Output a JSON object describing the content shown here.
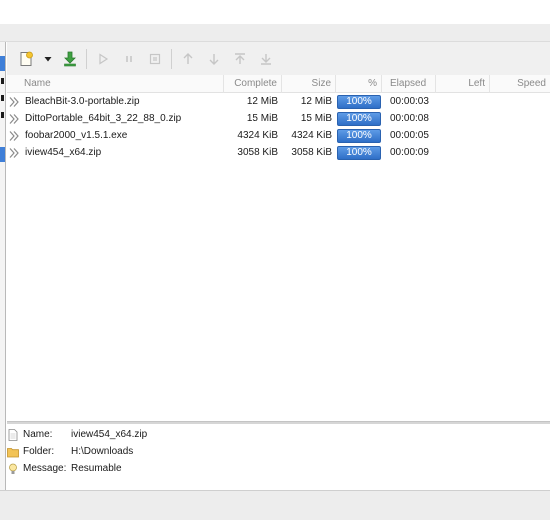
{
  "toolbar": {
    "buttons": [
      {
        "icon": "new-download-icon",
        "enabled": true
      },
      {
        "icon": "dropdown-arrow-icon",
        "enabled": true
      },
      {
        "icon": "download-icon",
        "enabled": true
      },
      {
        "icon": "start-icon",
        "enabled": false
      },
      {
        "icon": "pause-icon",
        "enabled": false
      },
      {
        "icon": "stop-icon",
        "enabled": false
      },
      {
        "icon": "move-up-icon",
        "enabled": false
      },
      {
        "icon": "move-down-icon",
        "enabled": false
      },
      {
        "icon": "move-top-icon",
        "enabled": false
      },
      {
        "icon": "move-bottom-icon",
        "enabled": false
      }
    ]
  },
  "columns": {
    "name": "Name",
    "complete": "Complete",
    "size": "Size",
    "percent": "%",
    "elapsed": "Elapsed",
    "left": "Left",
    "speed": "Speed"
  },
  "downloads": [
    {
      "name": "BleachBit-3.0-portable.zip",
      "complete": "12 MiB",
      "size": "12 MiB",
      "percent": "100%",
      "elapsed": "00:00:03",
      "left": "",
      "speed": ""
    },
    {
      "name": "DittoPortable_64bit_3_22_88_0.zip",
      "complete": "15 MiB",
      "size": "15 MiB",
      "percent": "100%",
      "elapsed": "00:00:08",
      "left": "",
      "speed": ""
    },
    {
      "name": "foobar2000_v1.5.1.exe",
      "complete": "4324 KiB",
      "size": "4324 KiB",
      "percent": "100%",
      "elapsed": "00:00:05",
      "left": "",
      "speed": ""
    },
    {
      "name": "iview454_x64.zip",
      "complete": "3058 KiB",
      "size": "3058 KiB",
      "percent": "100%",
      "elapsed": "00:00:09",
      "left": "",
      "speed": ""
    }
  ],
  "details": {
    "name_label": "Name:",
    "name_value": "iview454_x64.zip",
    "folder_label": "Folder:",
    "folder_value": "H:\\Downloads",
    "message_label": "Message:",
    "message_value": "Resumable"
  },
  "colors": {
    "progress_fill": "#3f7fd8",
    "selection": "#3f7fd8"
  }
}
